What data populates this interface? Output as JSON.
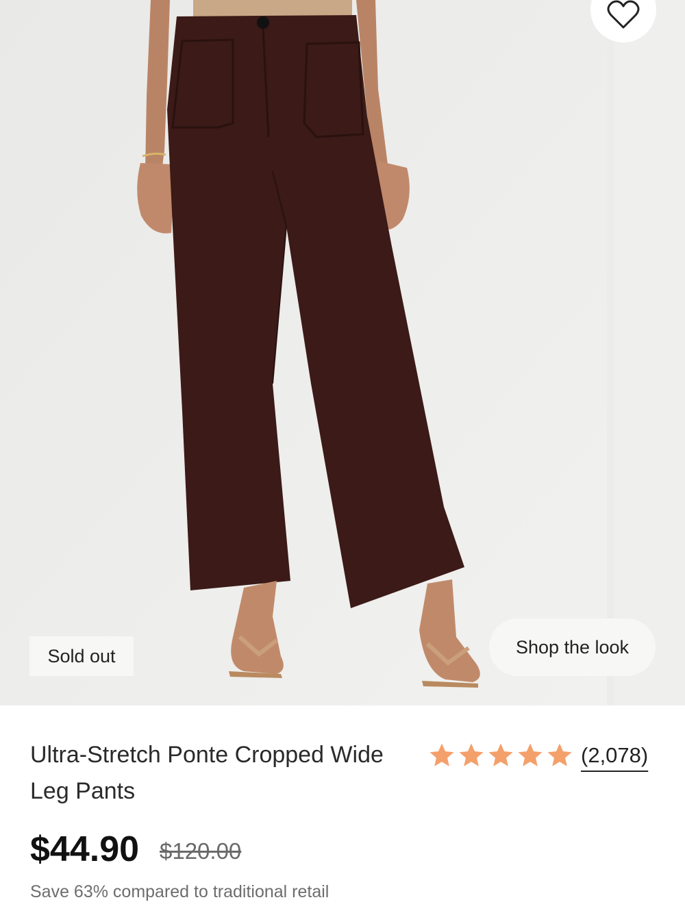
{
  "product": {
    "image_alt": "Model wearing brown wide leg pants with sandals",
    "badge": "Sold out",
    "shop_the_look": "Shop the look",
    "wishlist_icon": "heart-icon",
    "title": "Ultra-Stretch Ponte Cropped Wide Leg Pants",
    "rating": {
      "stars": 5,
      "review_count": "(2,078)",
      "star_color": "#f4a06b",
      "star_icon": "star-icon"
    },
    "price": "$44.90",
    "original_price": "$120.00",
    "savings_text": "Save 63% compared to traditional retail"
  },
  "colors": {
    "background": "#ececea",
    "pants": "#3b1a17",
    "text": "#1c1c1c",
    "muted": "#6d6d6d"
  }
}
